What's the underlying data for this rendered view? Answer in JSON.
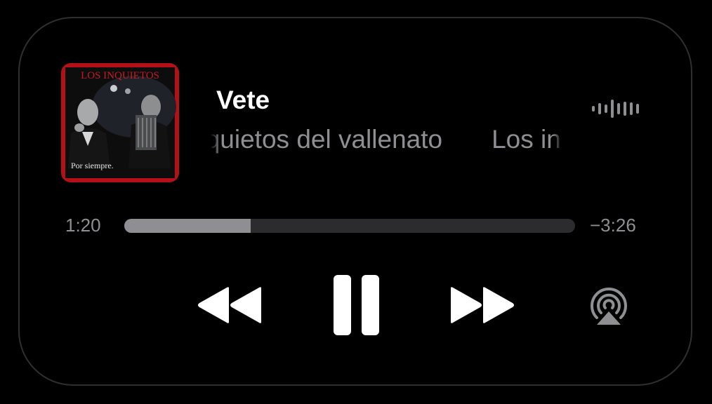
{
  "now_playing": {
    "title": "Vete",
    "subtitle_scroll": "Los inquietos del vallenato",
    "artwork": {
      "band_text": "LOS INQUIETOS",
      "album_text": "Por siempre.",
      "border_color": "#b3101a"
    },
    "level_icon": "audio-level-icon"
  },
  "progress": {
    "elapsed": "1:20",
    "remaining": "−3:26",
    "fraction": 0.28
  },
  "controls": {
    "rewind_icon": "rewind-icon",
    "pause_icon": "pause-icon",
    "forward_icon": "fast-forward-icon",
    "airplay_icon": "airplay-audio-icon"
  },
  "colors": {
    "background": "#000000",
    "primary_text": "#ffffff",
    "secondary_text": "#8e8e93",
    "track": "#2c2c2e",
    "track_fill": "#8e8e93"
  }
}
